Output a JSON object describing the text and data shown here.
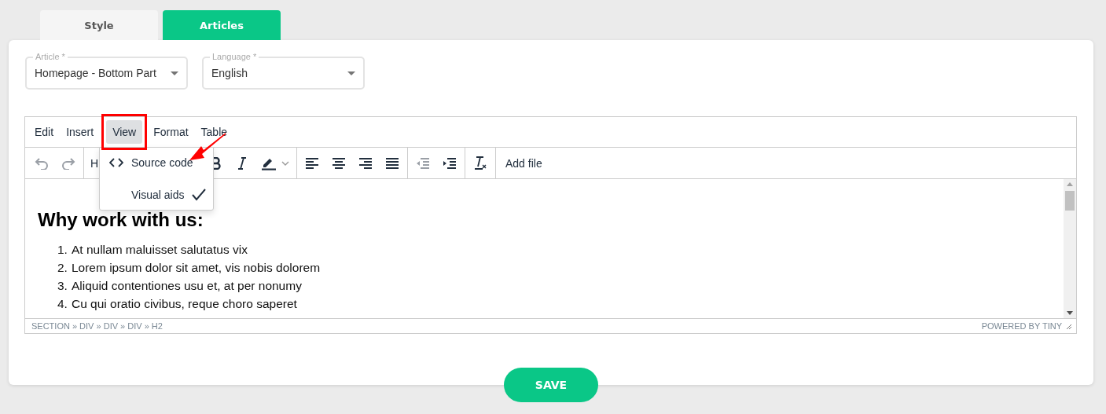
{
  "tabs": [
    {
      "label": "Style",
      "selected": false
    },
    {
      "label": "Articles",
      "selected": true
    }
  ],
  "fields": [
    {
      "label": "Article *",
      "value": "Homepage - Bottom Part"
    },
    {
      "label": "Language *",
      "value": "English"
    }
  ],
  "editor": {
    "menubar": [
      {
        "label": "Edit",
        "selected": false
      },
      {
        "label": "Insert",
        "selected": false
      },
      {
        "label": "View",
        "selected": true
      },
      {
        "label": "Format",
        "selected": false
      },
      {
        "label": "Table",
        "selected": false
      }
    ],
    "toolbar": [
      {
        "kind": "undo",
        "disabled": true
      },
      {
        "kind": "redo",
        "disabled": true
      },
      {
        "kind": "separator"
      },
      {
        "kind": "block",
        "text": "H"
      },
      {
        "kind": "bold",
        "disabled": false
      },
      {
        "kind": "italic",
        "disabled": false
      },
      {
        "kind": "highlight",
        "disabled": false
      },
      {
        "kind": "separator"
      },
      {
        "kind": "align-left",
        "disabled": false
      },
      {
        "kind": "align-center",
        "disabled": false
      },
      {
        "kind": "align-right",
        "disabled": false
      },
      {
        "kind": "justify",
        "disabled": false
      },
      {
        "kind": "separator"
      },
      {
        "kind": "outdent",
        "disabled": true
      },
      {
        "kind": "indent",
        "disabled": false
      },
      {
        "kind": "separator"
      },
      {
        "kind": "clear-format",
        "disabled": false
      },
      {
        "kind": "separator"
      },
      {
        "kind": "text-button",
        "text": "Add file"
      }
    ],
    "dropdown": [
      {
        "kind": "source",
        "label": "Source code",
        "checked": false
      },
      {
        "kind": "toggle",
        "label": "Visual aids",
        "checked": true
      }
    ],
    "heading": "Why work with us:",
    "list": [
      {
        "number": "1.",
        "text": "At nullam maluisset salutatus vix"
      },
      {
        "number": "2.",
        "text": "Lorem ipsum dolor sit amet, vis nobis dolorem"
      },
      {
        "number": "3.",
        "text": "Aliquid contentiones usu et, at per nonumy"
      },
      {
        "number": "4.",
        "text": "Cu qui oratio civibus, reque choro saperet"
      }
    ],
    "path": "SECTION » DIV » DIV » DIV » H2",
    "branding": "POWERED BY TINY"
  },
  "save_button": "SAVE"
}
